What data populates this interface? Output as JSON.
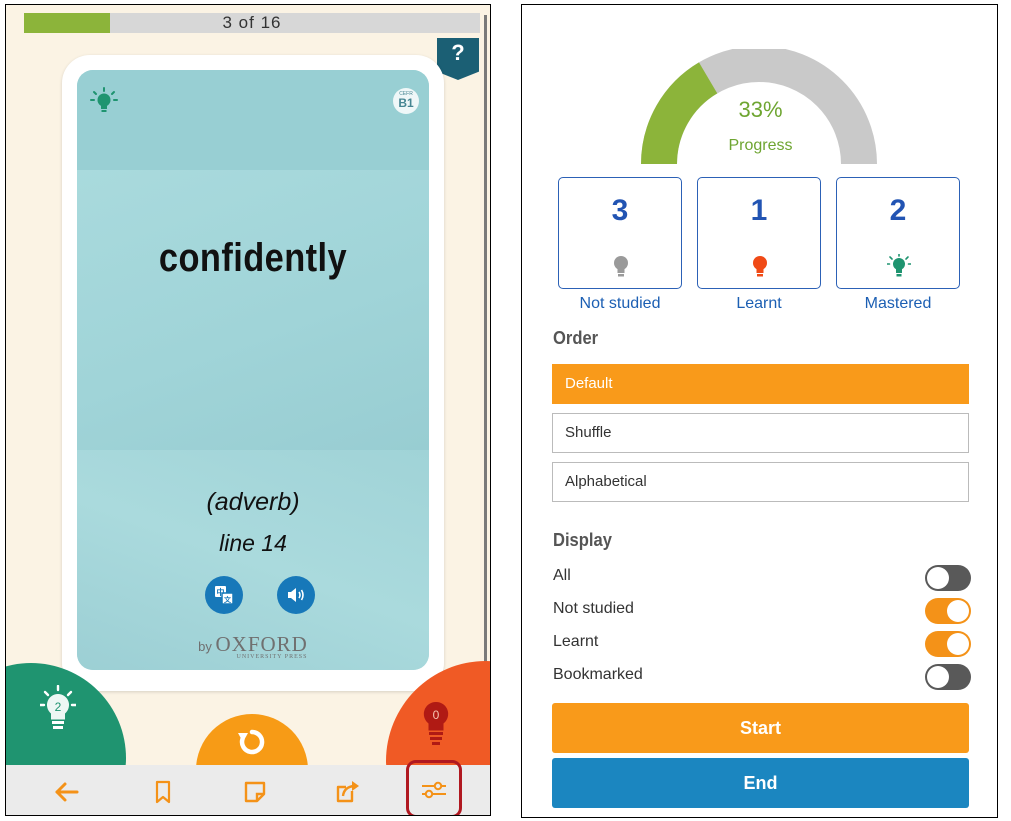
{
  "flashcard": {
    "progress_text": "3 of 16",
    "progress_fraction": 0.1875,
    "help_label": "?",
    "cefr_prefix": "CEFR",
    "cefr_level": "B1",
    "word": "confidently",
    "part_of_speech": "(adverb)",
    "line_ref": "line 14",
    "translate_icon": "translate-icon",
    "audio_icon": "speaker-icon",
    "publisher_by": "by",
    "publisher_name": "OXFORD",
    "publisher_sub": "UNIVERSITY PRESS",
    "mastered_count": "2",
    "learnt_count": "0",
    "colors": {
      "card": "#a4d6da",
      "mastered": "#1f9470",
      "learnt": "#f05a25",
      "reset": "#f79b16",
      "progress_fill": "#8cb43a"
    }
  },
  "toolbar": {
    "items": [
      "back-arrow-icon",
      "bookmark-icon",
      "note-icon",
      "share-icon",
      "settings-sliders-icon"
    ]
  },
  "settings": {
    "progress_percent": "33%",
    "progress_value": 0.33,
    "progress_label": "Progress",
    "stats": [
      {
        "count": "3",
        "label": "Not studied",
        "bulb_color": "#9a9a9a"
      },
      {
        "count": "1",
        "label": "Learnt",
        "bulb_color": "#f04a16"
      },
      {
        "count": "2",
        "label": "Mastered",
        "bulb_color": "#1f9470"
      }
    ],
    "order_heading": "Order",
    "order_options": [
      "Default",
      "Shuffle",
      "Alphabetical"
    ],
    "order_selected": "Default",
    "display_heading": "Display",
    "display_options": [
      {
        "label": "All",
        "on": false
      },
      {
        "label": "Not studied",
        "on": true
      },
      {
        "label": "Learnt",
        "on": true
      },
      {
        "label": "Bookmarked",
        "on": false
      }
    ],
    "start_label": "Start",
    "end_label": "End",
    "colors": {
      "accent": "#f99a1a",
      "end": "#1b86c0",
      "gauge_fill": "#8cb43a",
      "gauge_track": "#c9c9c9"
    }
  }
}
